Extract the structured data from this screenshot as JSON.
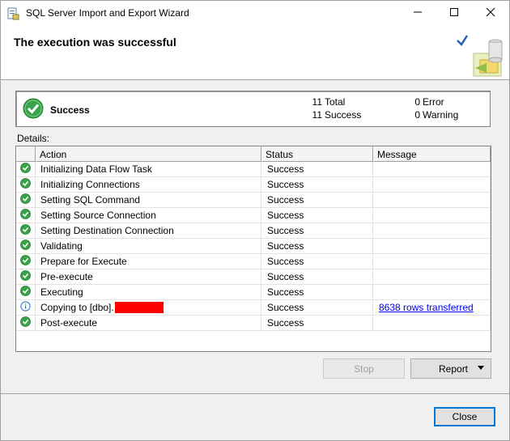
{
  "window": {
    "title": "SQL Server Import and Export Wizard",
    "minimize_icon": "minimize-icon",
    "maximize_icon": "maximize-icon",
    "close_icon": "close-icon"
  },
  "header": {
    "title": "The execution was successful"
  },
  "summary": {
    "status": "Success",
    "total_count": "11",
    "total_label": "Total",
    "success_count": "11",
    "success_label": "Success",
    "error_count": "0",
    "error_label": "Error",
    "warning_count": "0",
    "warning_label": "Warning"
  },
  "details": {
    "label": "Details:",
    "columns": [
      "Action",
      "Status",
      "Message"
    ],
    "rows": [
      {
        "icon": "success-icon",
        "action": "Initializing Data Flow Task",
        "status": "Success",
        "message": ""
      },
      {
        "icon": "success-icon",
        "action": "Initializing Connections",
        "status": "Success",
        "message": ""
      },
      {
        "icon": "success-icon",
        "action": "Setting SQL Command",
        "status": "Success",
        "message": ""
      },
      {
        "icon": "success-icon",
        "action": "Setting Source Connection",
        "status": "Success",
        "message": ""
      },
      {
        "icon": "success-icon",
        "action": "Setting Destination Connection",
        "status": "Success",
        "message": ""
      },
      {
        "icon": "success-icon",
        "action": "Validating",
        "status": "Success",
        "message": ""
      },
      {
        "icon": "success-icon",
        "action": "Prepare for Execute",
        "status": "Success",
        "message": ""
      },
      {
        "icon": "success-icon",
        "action": "Pre-execute",
        "status": "Success",
        "message": ""
      },
      {
        "icon": "success-icon",
        "action": "Executing",
        "status": "Success",
        "message": ""
      },
      {
        "icon": "info-icon",
        "action": "Copying to [dbo].",
        "status": "Success",
        "message": "8638 rows transferred"
      },
      {
        "icon": "success-icon",
        "action": "Post-execute",
        "status": "Success",
        "message": ""
      }
    ]
  },
  "buttons": {
    "stop": "Stop",
    "report": "Report",
    "close": "Close"
  },
  "colors": {
    "success_green": "#3aa34a",
    "info_blue": "#2a6fc9",
    "redaction": "#ff0000",
    "link": "#0000ee"
  }
}
